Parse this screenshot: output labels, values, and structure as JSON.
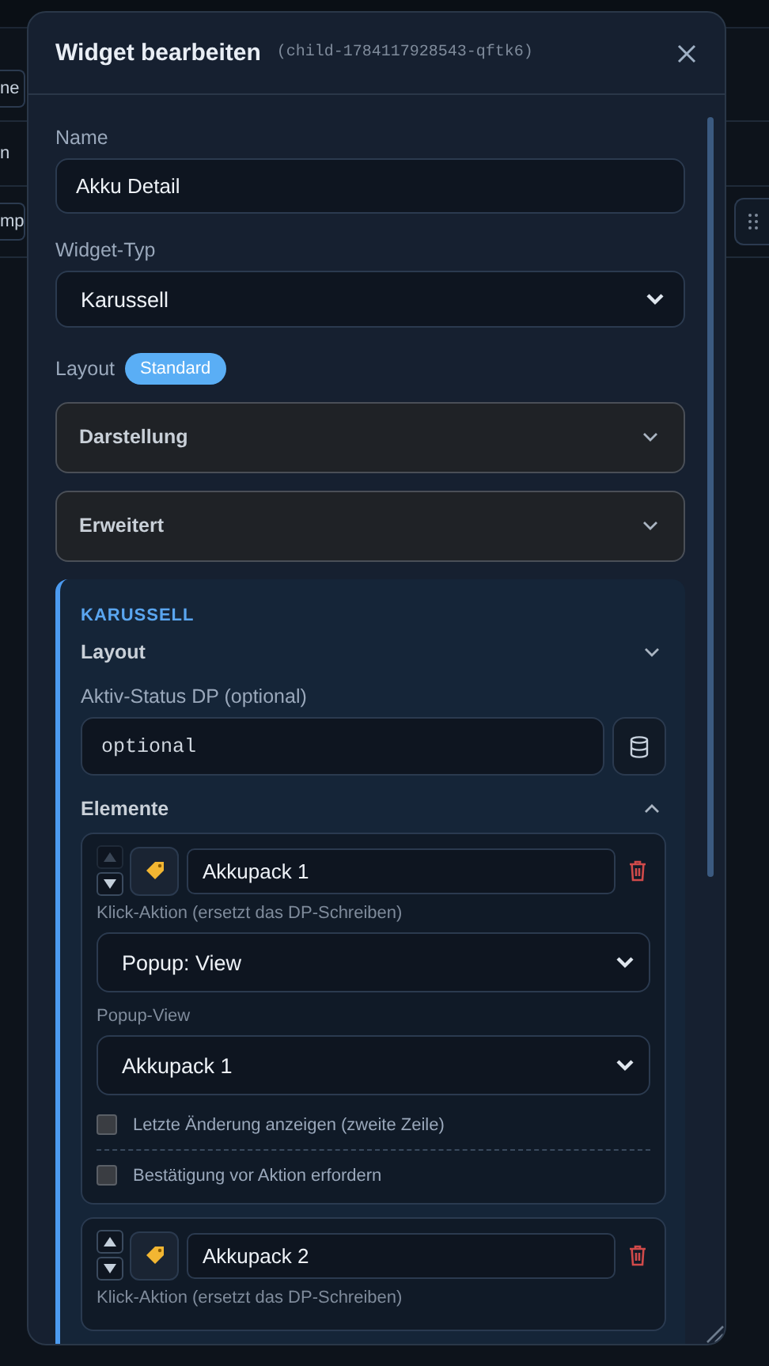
{
  "background": {
    "fragments": [
      "ne",
      "n",
      "mp"
    ]
  },
  "dialog": {
    "title": "Widget bearbeiten",
    "subtitle": "(child-1784117928543-qftk6)"
  },
  "fields": [
    {
      "kind": "input",
      "label": "Name",
      "value": "Akku Detail"
    },
    {
      "kind": "select",
      "label": "Widget-Typ",
      "value": "Karussell"
    }
  ],
  "layout": {
    "label": "Layout",
    "badge": "Standard"
  },
  "panels": [
    {
      "title": "Darstellung",
      "expanded": false
    },
    {
      "title": "Erweitert",
      "expanded": false
    }
  ],
  "carousel": {
    "heading": "KARUSSELL",
    "layout_section": {
      "title": "Layout",
      "expanded": false
    },
    "status_field": {
      "label": "Aktiv-Status DP (optional)",
      "placeholder": "optional"
    },
    "elements_section": {
      "title": "Elemente",
      "expanded": true,
      "items": [
        {
          "name": "Akkupack 1",
          "move_up": {
            "disabled": true
          },
          "move_down": {
            "disabled": false
          },
          "action_label": "Klick-Aktion (ersetzt das DP-Schreiben)",
          "action_value": "Popup: View",
          "view_label": "Popup-View",
          "view_value": "Akkupack 1",
          "options": [
            {
              "label": "Letzte Änderung anzeigen (zweite Zeile)",
              "checked": false
            },
            {
              "label": "Bestätigung vor Aktion erfordern",
              "checked": false
            }
          ]
        },
        {
          "name": "Akkupack 2",
          "move_up": {
            "disabled": false
          },
          "move_down": {
            "disabled": false
          },
          "action_label": "Klick-Aktion (ersetzt das DP-Schreiben)"
        }
      ]
    }
  }
}
